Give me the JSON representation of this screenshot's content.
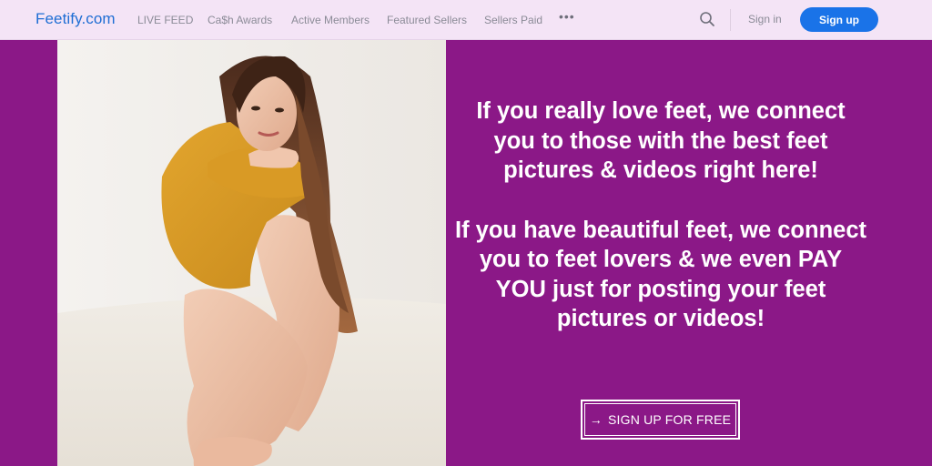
{
  "header": {
    "logo": "Feetify.com",
    "nav": [
      {
        "label": "LIVE FEED"
      },
      {
        "label": "Ca$h Awards"
      },
      {
        "label": "Active Members"
      },
      {
        "label": "Featured Sellers"
      },
      {
        "label": "Sellers Paid"
      }
    ],
    "more_icon": "more-horizontal-icon",
    "search_icon": "search-icon",
    "signin_label": "Sign in",
    "signup_label": "Sign up"
  },
  "hero": {
    "paragraph_1": "If you really love feet, we connect you to those with the best feet pictures & videos right here!",
    "paragraph_2": "If you have beautiful feet, we connect you to feet lovers & we even PAY YOU just for posting your feet pictures or videos!",
    "cta_icon": "arrow-right-icon",
    "cta_arrow": "→",
    "cta_label": "SIGN UP FOR FREE"
  },
  "colors": {
    "header_bg": "#f4e4f6",
    "hero_bg": "#8b1887",
    "brand_blue": "#1a73e8",
    "logo_blue": "#1f6ed4",
    "nav_text": "#8b8b97"
  }
}
